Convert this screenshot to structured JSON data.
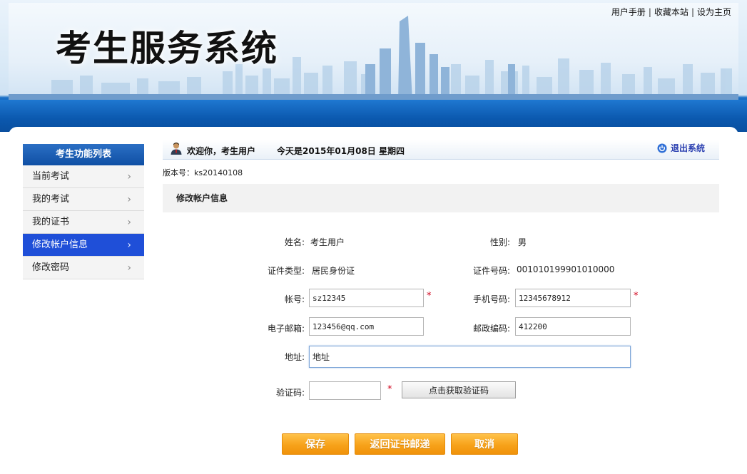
{
  "header": {
    "title": "考生服务系统",
    "links": [
      "用户手册",
      "收藏本站",
      "设为主页"
    ]
  },
  "sidebar": {
    "title": "考生功能列表",
    "items": [
      {
        "label": "当前考试",
        "active": false
      },
      {
        "label": "我的考试",
        "active": false
      },
      {
        "label": "我的证书",
        "active": false
      },
      {
        "label": "修改帐户信息",
        "active": true
      },
      {
        "label": "修改密码",
        "active": false
      }
    ]
  },
  "welcome": {
    "greeting": "欢迎你，考生用户",
    "date": "今天是2015年01月08日  星期四",
    "logout": "退出系统"
  },
  "version": "版本号：ks20140108",
  "section_title": "修改帐户信息",
  "form": {
    "name_label": "姓名:",
    "name_value": "考生用户",
    "gender_label": "性别:",
    "gender_value": "男",
    "id_type_label": "证件类型:",
    "id_type_value": "居民身份证",
    "id_number_label": "证件号码:",
    "id_number_value": "001010199901010000",
    "account_label": "帐号:",
    "account_value": "sz12345",
    "phone_label": "手机号码:",
    "phone_value": "12345678912",
    "email_label": "电子邮箱:",
    "email_value": "123456@qq.com",
    "postcode_label": "邮政编码:",
    "postcode_value": "412200",
    "address_label": "地址:",
    "address_value": "地址",
    "captcha_label": "验证码:",
    "captcha_value": "",
    "captcha_button": "点击获取验证码",
    "required_mark": "*"
  },
  "actions": {
    "save": "保存",
    "back": "返回证书邮递",
    "cancel": "取消"
  },
  "colors": {
    "accent_blue": "#1f4fd8",
    "header_blue": "#0b58ae",
    "button_orange": "#f7a21a",
    "required_red": "#d0021b"
  }
}
